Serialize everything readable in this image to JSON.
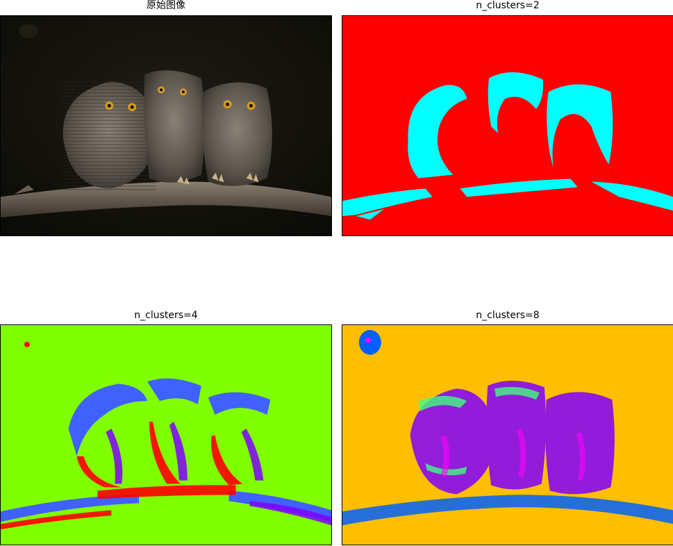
{
  "panels": [
    {
      "title": "原始图像"
    },
    {
      "title": "n_clusters=2",
      "palette": [
        "#ff0000",
        "#00ffff"
      ]
    },
    {
      "title": "n_clusters=4",
      "palette": [
        "#80ff00",
        "#ff0000",
        "#4060ff",
        "#8000ff"
      ]
    },
    {
      "title": "n_clusters=8",
      "palette": [
        "#ffbf00",
        "#0060ff",
        "#8000ff",
        "#ff00ff",
        "#40ff80",
        "#ff4000"
      ]
    }
  ]
}
